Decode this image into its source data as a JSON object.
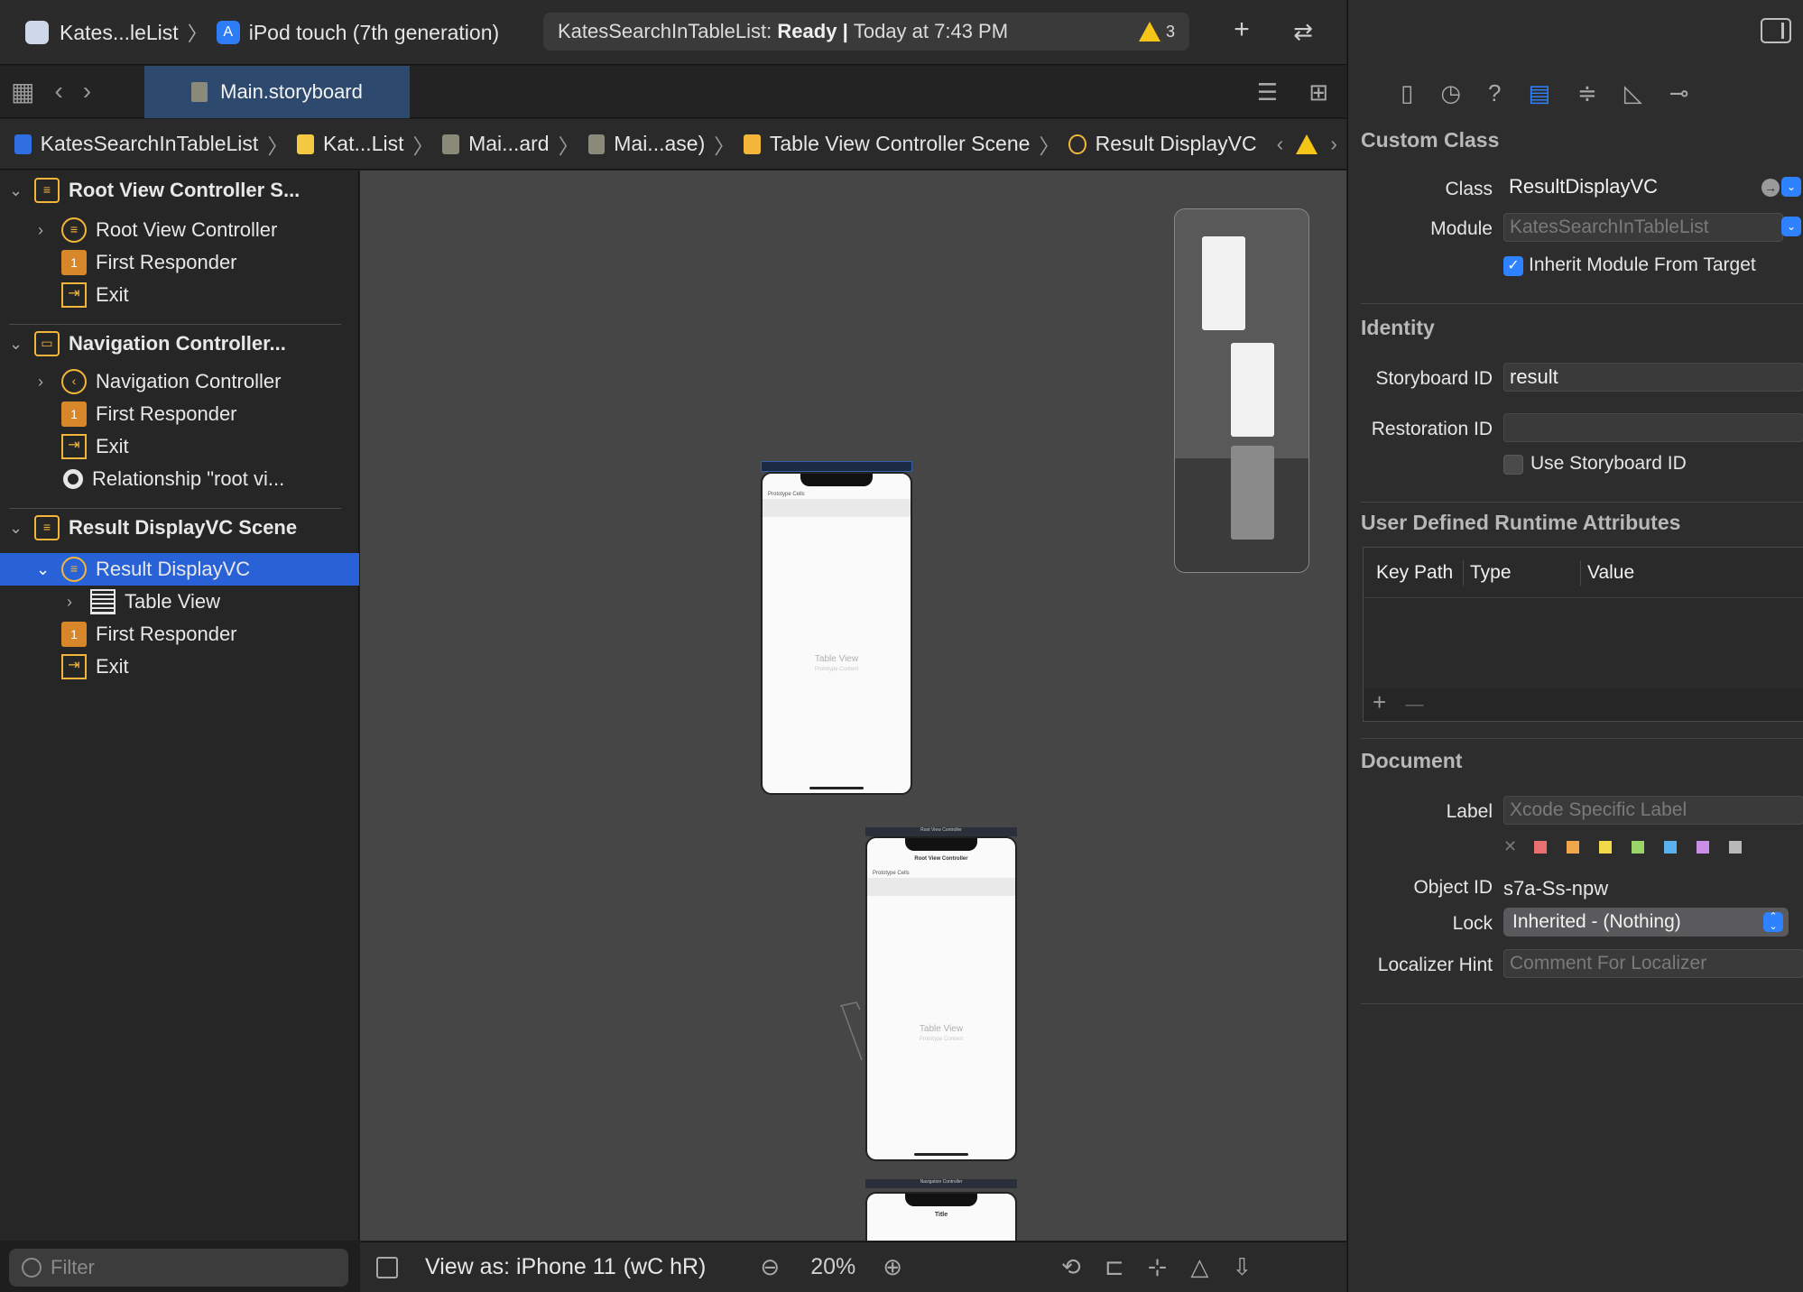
{
  "toolbar": {
    "scheme": "Kates...leList",
    "device": "iPod touch (7th generation)",
    "status_prefix": "KatesSearchInTableList:",
    "status_state": "Ready",
    "status_sep": "|",
    "status_time": "Today at 7:43 PM",
    "warning_count": "3",
    "add_glyph": "+",
    "swap_glyph": "⇄"
  },
  "tabbar": {
    "tab_label": "Main.storyboard"
  },
  "breadcrumb": [
    "KatesSearchInTableList",
    "Kat...List",
    "Mai...ard",
    "Mai...ase)",
    "Table View Controller Scene",
    "Result DisplayVC"
  ],
  "navigator": {
    "rows": [
      {
        "label": "Root View Controller S...",
        "bold": true
      },
      {
        "label": "Root View Controller"
      },
      {
        "label": "First Responder"
      },
      {
        "label": "Exit"
      },
      {
        "label": "Navigation Controller...",
        "bold": true
      },
      {
        "label": "Navigation Controller"
      },
      {
        "label": "First Responder"
      },
      {
        "label": "Exit"
      },
      {
        "label": "Relationship \"root vi..."
      },
      {
        "label": "Result DisplayVC Scene",
        "bold": true
      },
      {
        "label": "Result DisplayVC",
        "selected": true
      },
      {
        "label": "Table View"
      },
      {
        "label": "First Responder"
      },
      {
        "label": "Exit"
      }
    ],
    "filter_placeholder": "Filter"
  },
  "canvas": {
    "scene1": {
      "proto": "Prototype Cells",
      "table": "Table View",
      "sub": "Prototype Content"
    },
    "scene2": {
      "header": "Root View Controller",
      "nav_title": "Root View Controller",
      "proto": "Prototype Cells",
      "table": "Table View",
      "sub": "Prototype Content"
    },
    "scene3": {
      "header": "Navigation Controller",
      "nav_title": "Title"
    }
  },
  "bottombar": {
    "view_as": "View as: iPhone 11",
    "size_class": "(wC hR)",
    "zoom": "20%"
  },
  "inspector": {
    "custom_class_title": "Custom Class",
    "class_label": "Class",
    "class_value": "ResultDisplayVC",
    "module_label": "Module",
    "module_placeholder": "KatesSearchInTableList",
    "inherit_label": "Inherit Module From Target",
    "identity_title": "Identity",
    "storyboard_id_label": "Storyboard ID",
    "storyboard_id_value": "result",
    "restoration_id_label": "Restoration ID",
    "use_storyboard_id_label": "Use Storyboard ID",
    "udra_title": "User Defined Runtime Attributes",
    "col_keypath": "Key Path",
    "col_type": "Type",
    "col_value": "Value",
    "add_glyph": "+",
    "remove_glyph": "—",
    "document_title": "Document",
    "label_label": "Label",
    "label_placeholder": "Xcode Specific Label",
    "object_id_label": "Object ID",
    "object_id_value": "s7a-Ss-npw",
    "lock_label": "Lock",
    "lock_value": "Inherited - (Nothing)",
    "localizer_label": "Localizer Hint",
    "localizer_placeholder": "Comment For Localizer",
    "swatches": [
      "#e8706e",
      "#f0a64a",
      "#f3d94a",
      "#9bd56a",
      "#5ab1f0",
      "#cc8fe8",
      "#b8b8b8"
    ]
  }
}
